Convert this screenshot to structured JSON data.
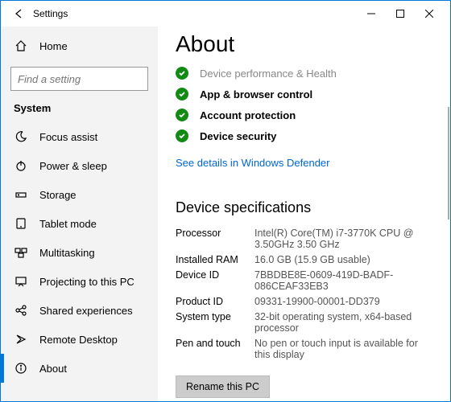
{
  "titlebar": {
    "app_name": "Settings"
  },
  "sidebar": {
    "home_label": "Home",
    "search_placeholder": "Find a setting",
    "group_header": "System",
    "items": [
      {
        "label": "Focus assist"
      },
      {
        "label": "Power & sleep"
      },
      {
        "label": "Storage"
      },
      {
        "label": "Tablet mode"
      },
      {
        "label": "Multitasking"
      },
      {
        "label": "Projecting to this PC"
      },
      {
        "label": "Shared experiences"
      },
      {
        "label": "Remote Desktop"
      },
      {
        "label": "About"
      }
    ]
  },
  "content": {
    "page_title": "About",
    "statuses": [
      {
        "label": "Device performance & Health",
        "partial": true
      },
      {
        "label": "App & browser control"
      },
      {
        "label": "Account protection"
      },
      {
        "label": "Device security"
      }
    ],
    "defender_link": "See details in Windows Defender",
    "specs_header": "Device specifications",
    "specs": {
      "processor_label": "Processor",
      "processor_value": "Intel(R) Core(TM) i7-3770K CPU @ 3.50GHz 3.50 GHz",
      "ram_label": "Installed RAM",
      "ram_value": "16.0 GB (15.9 GB usable)",
      "deviceid_label": "Device ID",
      "deviceid_value": "7BBDBE8E-0609-419D-BADF-086CEAF33EB3",
      "productid_label": "Product ID",
      "productid_value": "09331-19900-00001-DD379",
      "systype_label": "System type",
      "systype_value": "32-bit operating system, x64-based processor",
      "pen_label": "Pen and touch",
      "pen_value": "No pen or touch input is available for this display"
    },
    "rename_button": "Rename this PC"
  }
}
